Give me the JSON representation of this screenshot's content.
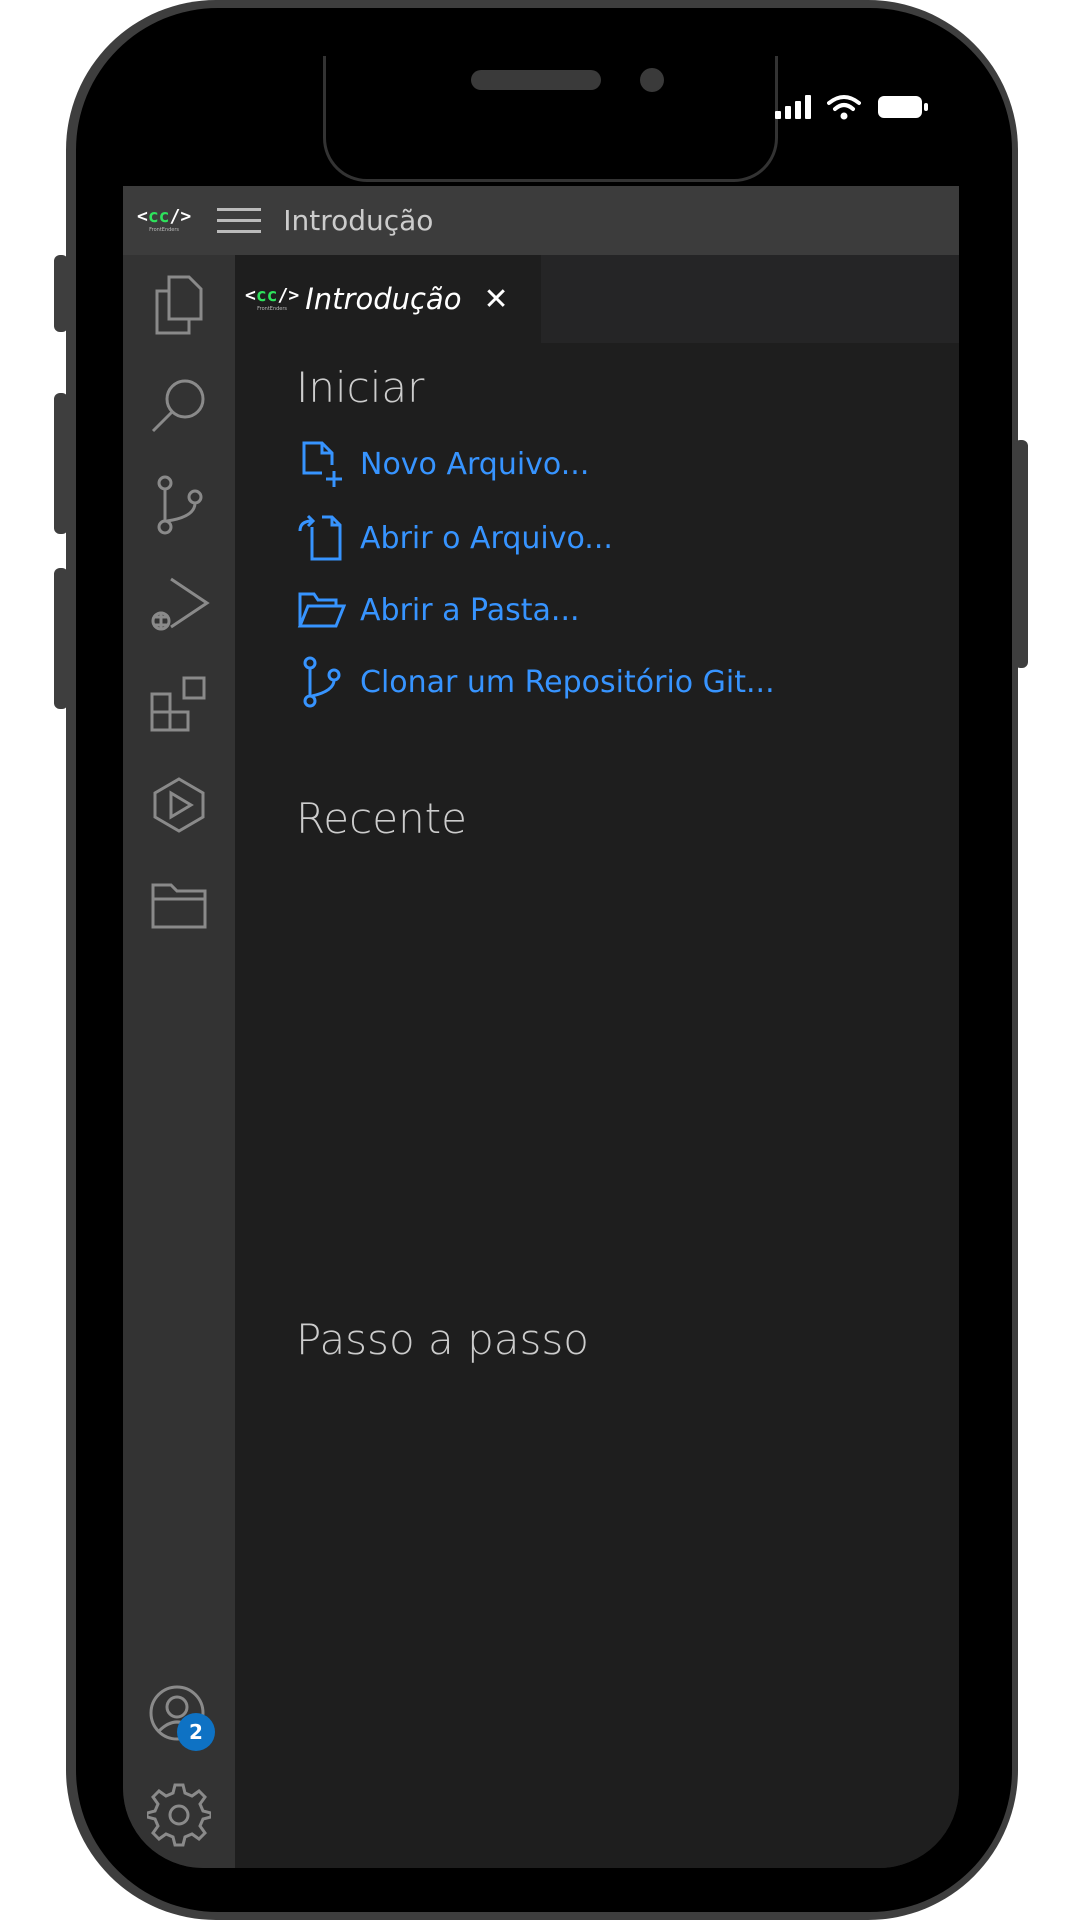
{
  "app": {
    "window_title": "Introdução",
    "logo_text": "<cc/>",
    "logo_sub": "FrontEnders"
  },
  "tab": {
    "label": "Introdução",
    "close_glyph": "✕"
  },
  "sections": {
    "start_heading": "Iniciar",
    "recent_heading": "Recente",
    "walkthrough_heading": "Passo a passo"
  },
  "start_links": [
    {
      "label": "Novo Arquivo...",
      "icon": "new-file-icon"
    },
    {
      "label": "Abrir o Arquivo...",
      "icon": "open-file-icon"
    },
    {
      "label": "Abrir a Pasta...",
      "icon": "open-folder-icon"
    },
    {
      "label": "Clonar um Repositório Git...",
      "icon": "git-branch-icon"
    }
  ],
  "activity_bar": {
    "items": [
      "explorer-icon",
      "search-icon",
      "source-control-icon",
      "run-debug-icon",
      "extensions-icon",
      "remote-explorer-icon",
      "folder-icon"
    ],
    "accounts_badge": "2"
  },
  "colors": {
    "accent_link": "#3794ff",
    "badge": "#0e72c4",
    "logo_green": "#2ee25c"
  }
}
